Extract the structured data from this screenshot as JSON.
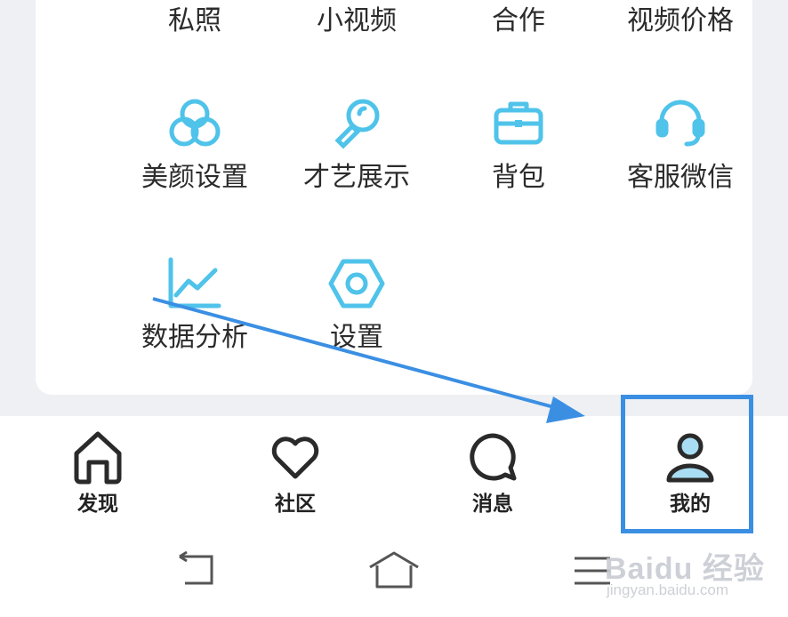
{
  "grid": {
    "row1": [
      "私照",
      "小视频",
      "合作",
      "视频价格"
    ],
    "row2": [
      {
        "label": "美颜设置",
        "icon": "beauty-circles-icon"
      },
      {
        "label": "才艺展示",
        "icon": "magnifier-icon"
      },
      {
        "label": "背包",
        "icon": "briefcase-icon"
      },
      {
        "label": "客服微信",
        "icon": "headset-icon"
      }
    ],
    "row3": [
      {
        "label": "数据分析",
        "icon": "line-chart-icon"
      },
      {
        "label": "设置",
        "icon": "hex-nut-icon"
      }
    ]
  },
  "tabs": [
    {
      "label": "发现",
      "icon": "home-icon"
    },
    {
      "label": "社区",
      "icon": "heart-icon"
    },
    {
      "label": "消息",
      "icon": "chat-bubble-icon"
    },
    {
      "label": "我的",
      "icon": "user-icon",
      "active": true
    }
  ],
  "watermark": {
    "brand": "Baidu 经验",
    "sub": "jingyan.baidu.com"
  },
  "colors": {
    "icon_accent": "#4fc3ea",
    "annotation": "#3b8fe3",
    "text": "#2b2b2b"
  }
}
